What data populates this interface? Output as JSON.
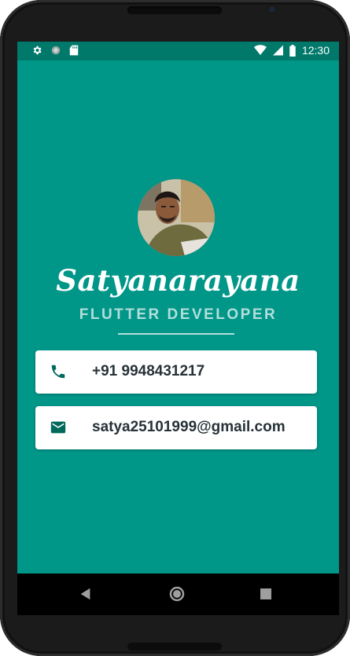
{
  "status_bar": {
    "time": "12:30",
    "icons": [
      "settings-icon",
      "sync-icon",
      "sd-card-icon",
      "wifi-icon",
      "signal-icon",
      "battery-icon"
    ]
  },
  "profile": {
    "name": "Satyanarayana",
    "title": "FLUTTER DEVELOPER"
  },
  "contacts": [
    {
      "icon": "phone-icon",
      "text": "+91 9948431217"
    },
    {
      "icon": "email-icon",
      "text": "satya25101999@gmail.com"
    }
  ],
  "nav_bar": {
    "buttons": [
      "back-button",
      "home-button",
      "recents-button"
    ]
  },
  "colors": {
    "background": "#009688",
    "status_bar": "#00796B",
    "accent_text": "#B2DFDB",
    "card": "#FFFFFF",
    "icon": "#00695C"
  }
}
